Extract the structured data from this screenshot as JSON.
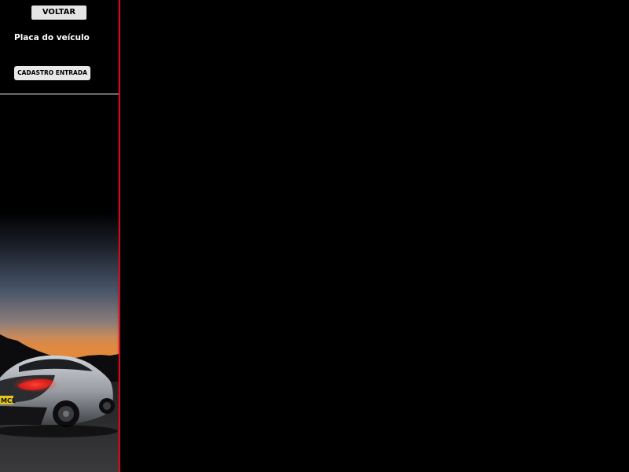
{
  "sidebar": {
    "back_label": "VOLTAR",
    "plate_label": "Placa do veículo",
    "register_label": "CADASTRO ENTRADA",
    "image": {
      "subject": "sports-car-at-dusk",
      "plate_text": "MCL"
    }
  },
  "colors": {
    "background": "#000000",
    "accent_rule": "#c8101a",
    "button_bg": "#e4e4e4",
    "label_text": "#ffffff"
  }
}
